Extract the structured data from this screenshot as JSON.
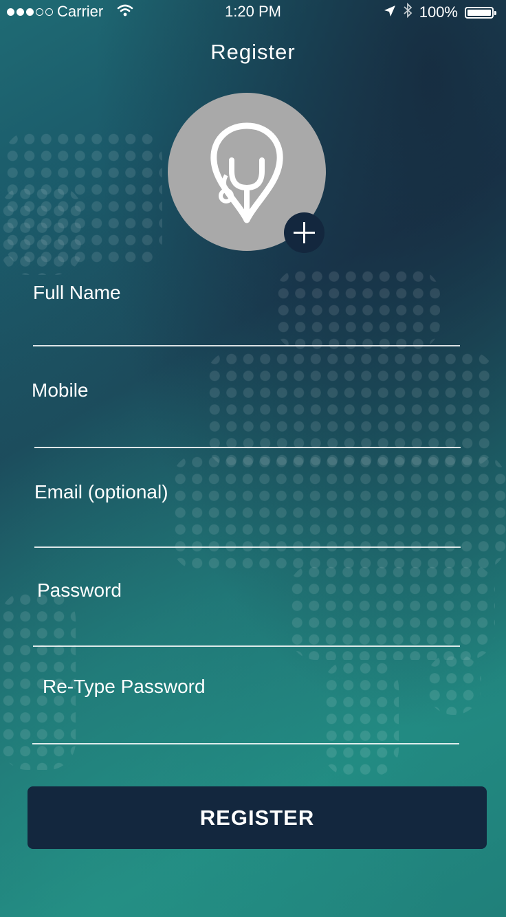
{
  "status_bar": {
    "carrier": "Carrier",
    "time": "1:20 PM",
    "battery": "100%"
  },
  "header": {
    "title": "Register"
  },
  "avatar": {
    "icon": "stethoscope-icon",
    "add_icon": "plus-icon"
  },
  "form": {
    "full_name": {
      "label": "Full Name",
      "value": ""
    },
    "mobile": {
      "label": "Mobile",
      "value": ""
    },
    "email": {
      "label": "Email (optional)",
      "value": ""
    },
    "password": {
      "label": "Password",
      "value": ""
    },
    "retype_password": {
      "label": "Re-Type Password",
      "value": ""
    }
  },
  "register_button": {
    "label": "REGISTER"
  },
  "colors": {
    "button_bg": "#13273e",
    "avatar_bg": "#a9a9a9",
    "text": "#ffffff"
  }
}
